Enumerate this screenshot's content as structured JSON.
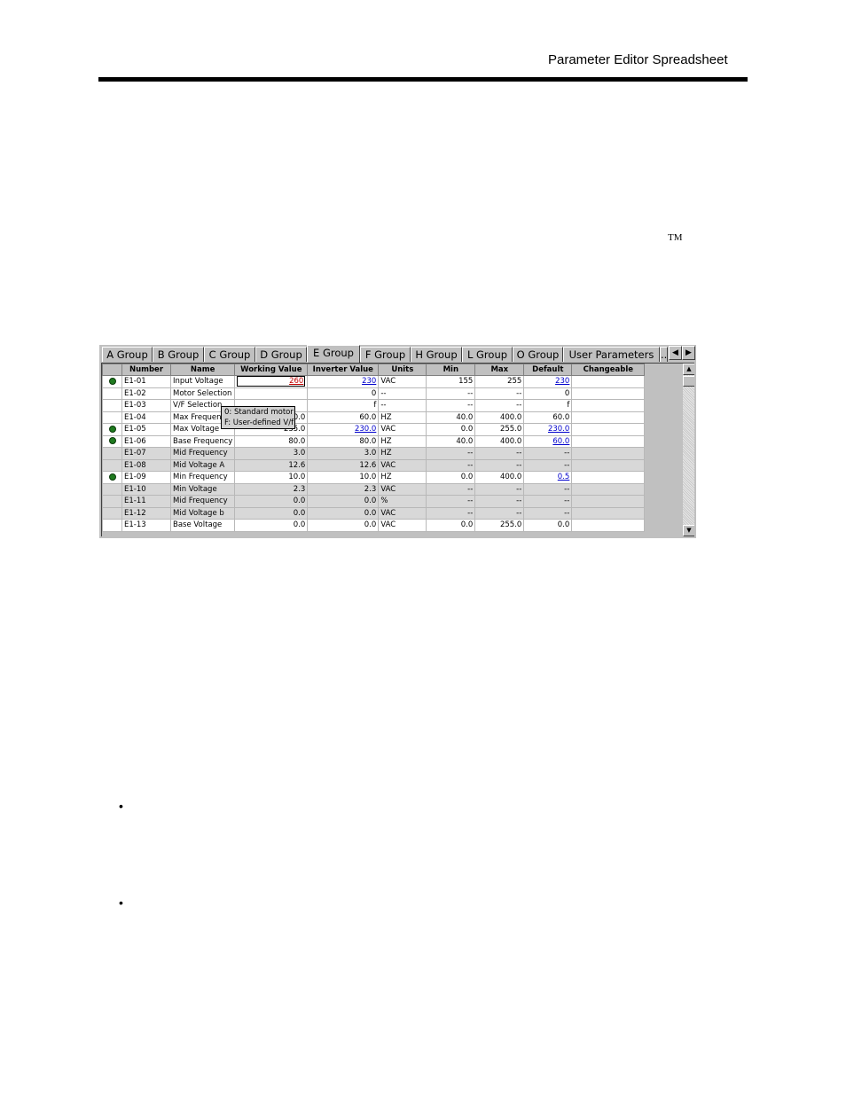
{
  "header": {
    "title": "Parameter Editor Spreadsheet"
  },
  "trademark": "TM",
  "bullets": [
    "•",
    "•"
  ],
  "tabs": [
    "A Group",
    "B Group",
    "C Group",
    "D Group",
    "E Group",
    "F Group",
    "H Group",
    "L Group",
    "O Group",
    "User Parameters",
    "..."
  ],
  "active_tab": "E Group",
  "nav": {
    "left": "◀",
    "right": "▶",
    "up": "▲",
    "down": "▼"
  },
  "columns": [
    "",
    "Number",
    "Name",
    "Working Value",
    "Inverter Value",
    "Units",
    "Min",
    "Max",
    "Default",
    "Changeable"
  ],
  "rows": [
    {
      "icon": true,
      "ro": false,
      "number": "E1-01",
      "name": "Input Voltage",
      "working": "260",
      "inverter": "230",
      "units": "VAC",
      "min": "155",
      "max": "255",
      "def": "230"
    },
    {
      "icon": false,
      "ro": false,
      "number": "E1-02",
      "name": "Motor Selection",
      "working": "",
      "inverter": "0",
      "units": "--",
      "min": "--",
      "max": "--",
      "def": "0"
    },
    {
      "icon": false,
      "ro": false,
      "number": "E1-03",
      "name": "V/F Selection",
      "working": "",
      "inverter": "f",
      "units": "--",
      "min": "--",
      "max": "--",
      "def": "f"
    },
    {
      "icon": false,
      "ro": false,
      "number": "E1-04",
      "name": "Max Frequency",
      "working": "60.0",
      "inverter": "60.0",
      "units": "HZ",
      "min": "40.0",
      "max": "400.0",
      "def": "60.0"
    },
    {
      "icon": true,
      "ro": false,
      "number": "E1-05",
      "name": "Max Voltage",
      "working": "235.0",
      "inverter": "230.0",
      "units": "VAC",
      "min": "0.0",
      "max": "255.0",
      "def": "230.0"
    },
    {
      "icon": true,
      "ro": false,
      "number": "E1-06",
      "name": "Base Frequency",
      "working": "80.0",
      "inverter": "80.0",
      "units": "HZ",
      "min": "40.0",
      "max": "400.0",
      "def": "60.0"
    },
    {
      "icon": false,
      "ro": true,
      "number": "E1-07",
      "name": "Mid Frequency",
      "working": "3.0",
      "inverter": "3.0",
      "units": "HZ",
      "min": "--",
      "max": "--",
      "def": "--"
    },
    {
      "icon": false,
      "ro": true,
      "number": "E1-08",
      "name": "Mid Voltage A",
      "working": "12.6",
      "inverter": "12.6",
      "units": "VAC",
      "min": "--",
      "max": "--",
      "def": "--"
    },
    {
      "icon": true,
      "ro": false,
      "number": "E1-09",
      "name": "Min Frequency",
      "working": "10.0",
      "inverter": "10.0",
      "units": "HZ",
      "min": "0.0",
      "max": "400.0",
      "def": "0.5"
    },
    {
      "icon": false,
      "ro": true,
      "number": "E1-10",
      "name": "Min Voltage",
      "working": "2.3",
      "inverter": "2.3",
      "units": "VAC",
      "min": "--",
      "max": "--",
      "def": "--"
    },
    {
      "icon": false,
      "ro": true,
      "number": "E1-11",
      "name": "Mid Frequency",
      "working": "0.0",
      "inverter": "0.0",
      "units": "%",
      "min": "--",
      "max": "--",
      "def": "--"
    },
    {
      "icon": false,
      "ro": true,
      "number": "E1-12",
      "name": "Mid Voltage b",
      "working": "0.0",
      "inverter": "0.0",
      "units": "VAC",
      "min": "--",
      "max": "--",
      "def": "--"
    },
    {
      "icon": false,
      "ro": false,
      "number": "E1-13",
      "name": "Base Voltage",
      "working": "0.0",
      "inverter": "0.0",
      "units": "VAC",
      "min": "0.0",
      "max": "255.0",
      "def": "0.0"
    }
  ],
  "dropdown": [
    "0: Standard motor",
    "F: User-defined V/f"
  ],
  "link_cells": {
    "inverter": [
      "E1-01",
      "E1-05"
    ],
    "def": [
      "E1-01",
      "E1-05",
      "E1-06",
      "E1-09"
    ]
  }
}
